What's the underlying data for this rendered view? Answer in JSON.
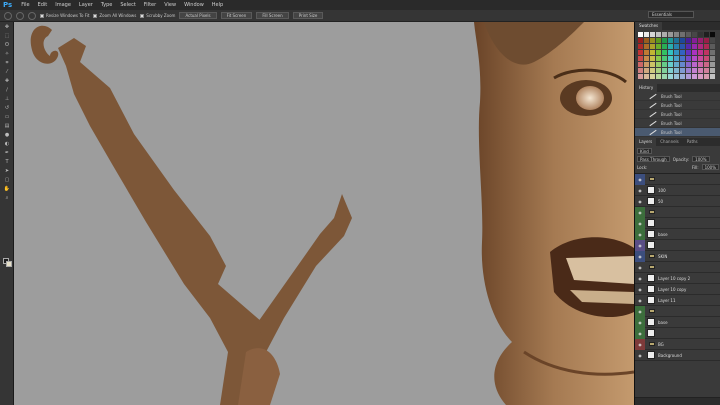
{
  "menu": {
    "logo": "Ps",
    "items": [
      "File",
      "Edit",
      "Image",
      "Layer",
      "Type",
      "Select",
      "Filter",
      "View",
      "Window",
      "Help"
    ]
  },
  "options": {
    "resize_windows": "Resize Windows To Fit",
    "zoom_all": "Zoom All Windows",
    "scrubby_zoom": "Scrubby Zoom",
    "actual_pixels": "Actual Pixels",
    "fit_screen": "Fit Screen",
    "fill_screen": "Fill Screen",
    "print_size": "Print Size",
    "workspace": "Essentials"
  },
  "panels": {
    "swatches_tab": "Swatches",
    "history_tab": "History",
    "history_items": [
      "Brush Tool",
      "Brush Tool",
      "Brush Tool",
      "Brush Tool",
      "Brush Tool"
    ],
    "layers_tab": "Layers",
    "channels_tab": "Channels",
    "paths_tab": "Paths",
    "kind_label": "Kind",
    "blend_mode": "Pass Through",
    "opacity_label": "Opacity:",
    "opacity_value": "100%",
    "lock_label": "Lock:",
    "fill_label": "Fill:",
    "fill_value": "100%",
    "layers": [
      {
        "name": "",
        "type": "folder",
        "eye": "blue"
      },
      {
        "name": "100",
        "type": "layer",
        "eye": "none"
      },
      {
        "name": "50",
        "type": "layer",
        "eye": "none"
      },
      {
        "name": "",
        "type": "folder",
        "eye": "green"
      },
      {
        "name": "",
        "type": "layer",
        "eye": "green"
      },
      {
        "name": "base",
        "type": "layer",
        "eye": "green"
      },
      {
        "name": "",
        "type": "layer",
        "eye": "purple"
      },
      {
        "name": "SKIN",
        "type": "folder",
        "eye": "blue"
      },
      {
        "name": "",
        "type": "folder",
        "eye": "none"
      },
      {
        "name": "Layer 10 copy 2",
        "type": "layer",
        "eye": "none"
      },
      {
        "name": "Layer 10 copy",
        "type": "layer",
        "eye": "none"
      },
      {
        "name": "Layer 11",
        "type": "layer",
        "eye": "none"
      },
      {
        "name": "",
        "type": "folder",
        "eye": "green"
      },
      {
        "name": "base",
        "type": "layer",
        "eye": "green"
      },
      {
        "name": "",
        "type": "layer",
        "eye": "green"
      },
      {
        "name": "BG",
        "type": "folder",
        "eye": "red"
      },
      {
        "name": "Background",
        "type": "layer",
        "eye": "none"
      }
    ]
  },
  "colors": {
    "canvas_bg": "#9d9d9d",
    "staff": "#7a5435",
    "skin": "#9a6e4a",
    "ps_blue": "#3da9f5"
  }
}
